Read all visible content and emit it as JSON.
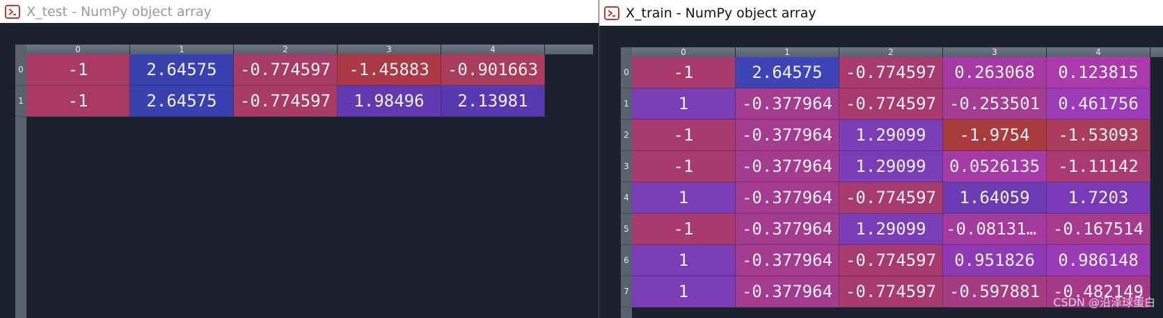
{
  "x_test": {
    "title": "X_test - NumPy object array",
    "columns": [
      "0",
      "1",
      "2",
      "3",
      "4"
    ],
    "rows": [
      {
        "label": "0",
        "cells": [
          {
            "text": "-1",
            "bg": "#a83b63"
          },
          {
            "text": "2.64575",
            "bg": "#3941b0"
          },
          {
            "text": "-0.774597",
            "bg": "#a83b63"
          },
          {
            "text": "-1.45883",
            "bg": "#aa3845"
          },
          {
            "text": "-0.901663",
            "bg": "#a93b5d"
          }
        ]
      },
      {
        "label": "1",
        "cells": [
          {
            "text": "-1",
            "bg": "#a83b63"
          },
          {
            "text": "2.64575",
            "bg": "#3941b0"
          },
          {
            "text": "-0.774597",
            "bg": "#a83b63"
          },
          {
            "text": "1.98496",
            "bg": "#6139b0"
          },
          {
            "text": "2.13981",
            "bg": "#5639b0"
          }
        ]
      }
    ]
  },
  "x_train": {
    "title": "X_train - NumPy object array",
    "columns": [
      "0",
      "1",
      "2",
      "3",
      "4"
    ],
    "rows": [
      {
        "label": "0",
        "cells": [
          {
            "text": "-1",
            "bg": "#a83b6e"
          },
          {
            "text": "2.64575",
            "bg": "#3d44b5"
          },
          {
            "text": "-0.774597",
            "bg": "#a83b6e"
          },
          {
            "text": "0.263068",
            "bg": "#a53aa2"
          },
          {
            "text": "0.123815",
            "bg": "#aa3aac"
          }
        ]
      },
      {
        "label": "1",
        "cells": [
          {
            "text": "1",
            "bg": "#7a3db5"
          },
          {
            "text": "-0.377964",
            "bg": "#a33c8e"
          },
          {
            "text": "-0.774597",
            "bg": "#a83b6e"
          },
          {
            "text": "-0.253501",
            "bg": "#a43c8f"
          },
          {
            "text": "0.461756",
            "bg": "#9d3ab5"
          }
        ]
      },
      {
        "label": "2",
        "cells": [
          {
            "text": "-1",
            "bg": "#a83b6e"
          },
          {
            "text": "-0.377964",
            "bg": "#a33c8e"
          },
          {
            "text": "1.29099",
            "bg": "#7a3db5"
          },
          {
            "text": "-1.9754",
            "bg": "#a93a3e"
          },
          {
            "text": "-1.53093",
            "bg": "#ab3d5c"
          }
        ]
      },
      {
        "label": "3",
        "cells": [
          {
            "text": "-1",
            "bg": "#a83b6e"
          },
          {
            "text": "-0.377964",
            "bg": "#a33c8e"
          },
          {
            "text": "1.29099",
            "bg": "#7a3db5"
          },
          {
            "text": "0.0526135",
            "bg": "#a63aa6"
          },
          {
            "text": "-1.11142",
            "bg": "#a93b72"
          }
        ]
      },
      {
        "label": "4",
        "cells": [
          {
            "text": "1",
            "bg": "#7a3db5"
          },
          {
            "text": "-0.377964",
            "bg": "#a33c8e"
          },
          {
            "text": "-0.774597",
            "bg": "#a83b6e"
          },
          {
            "text": "1.64059",
            "bg": "#6a3bb2"
          },
          {
            "text": "1.7203",
            "bg": "#7a3ab8"
          }
        ]
      },
      {
        "label": "5",
        "cells": [
          {
            "text": "-1",
            "bg": "#a83b6e"
          },
          {
            "text": "-0.377964",
            "bg": "#a33c8e"
          },
          {
            "text": "1.29099",
            "bg": "#7a3db5"
          },
          {
            "text": "-0.08131…",
            "bg": "#a53a9e",
            "ellipsis": true
          },
          {
            "text": "-0.167514",
            "bg": "#a63a8c"
          }
        ]
      },
      {
        "label": "6",
        "cells": [
          {
            "text": "1",
            "bg": "#7a3db5"
          },
          {
            "text": "-0.377964",
            "bg": "#a33c8e"
          },
          {
            "text": "-0.774597",
            "bg": "#a83b6e"
          },
          {
            "text": "0.951826",
            "bg": "#8c3bb4"
          },
          {
            "text": "0.986148",
            "bg": "#9a3ab4"
          }
        ]
      },
      {
        "label": "7",
        "cells": [
          {
            "text": "1",
            "bg": "#7a3db5"
          },
          {
            "text": "-0.377964",
            "bg": "#a33c8e"
          },
          {
            "text": "-0.774597",
            "bg": "#a83b6e"
          },
          {
            "text": "-0.597881",
            "bg": "#a53b82"
          },
          {
            "text": "-0.482149",
            "bg": "#a63a88"
          }
        ]
      }
    ]
  },
  "watermark": "CSDN @沿泽球蛋白",
  "icon": "spyder-app-icon"
}
